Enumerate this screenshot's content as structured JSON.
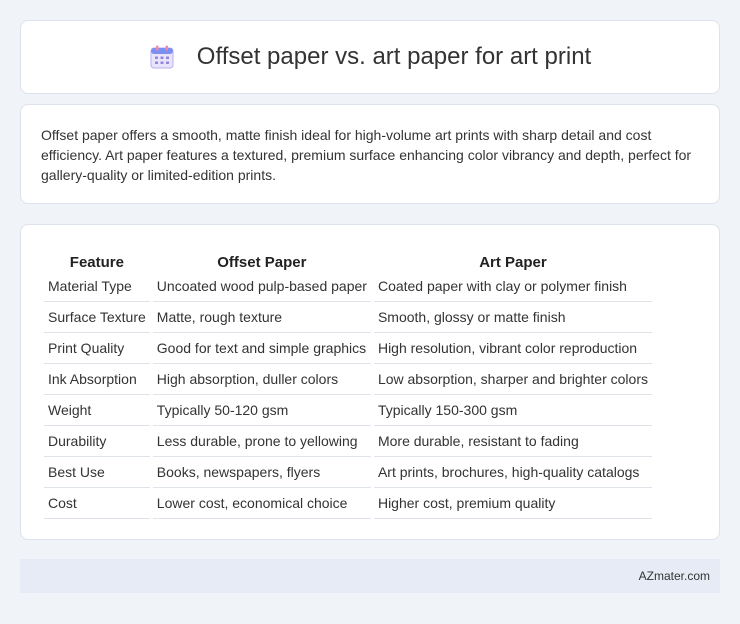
{
  "header": {
    "title": "Offset paper vs. art paper for art print",
    "icon": "calendar-icon"
  },
  "intro": {
    "text": "Offset paper offers a smooth, matte finish ideal for high-volume art prints with sharp detail and cost efficiency. Art paper features a textured, premium surface enhancing color vibrancy and depth, perfect for gallery-quality or limited-edition prints."
  },
  "table": {
    "headers": [
      "Feature",
      "Offset Paper",
      "Art Paper"
    ],
    "rows": [
      [
        "Material Type",
        "Uncoated wood pulp-based paper",
        "Coated paper with clay or polymer finish"
      ],
      [
        "Surface Texture",
        "Matte, rough texture",
        "Smooth, glossy or matte finish"
      ],
      [
        "Print Quality",
        "Good for text and simple graphics",
        "High resolution, vibrant color reproduction"
      ],
      [
        "Ink Absorption",
        "High absorption, duller colors",
        "Low absorption, sharper and brighter colors"
      ],
      [
        "Weight",
        "Typically 50-120 gsm",
        "Typically 150-300 gsm"
      ],
      [
        "Durability",
        "Less durable, prone to yellowing",
        "More durable, resistant to fading"
      ],
      [
        "Best Use",
        "Books, newspapers, flyers",
        "Art prints, brochures, high-quality catalogs"
      ],
      [
        "Cost",
        "Lower cost, economical choice",
        "Higher cost, premium quality"
      ]
    ]
  },
  "footer": {
    "brand": "AZmater.com"
  },
  "colors": {
    "background": "#f0f3f8",
    "card": "#ffffff",
    "footer": "#e6ebf5",
    "icon_accent": "#6c8cf0"
  }
}
